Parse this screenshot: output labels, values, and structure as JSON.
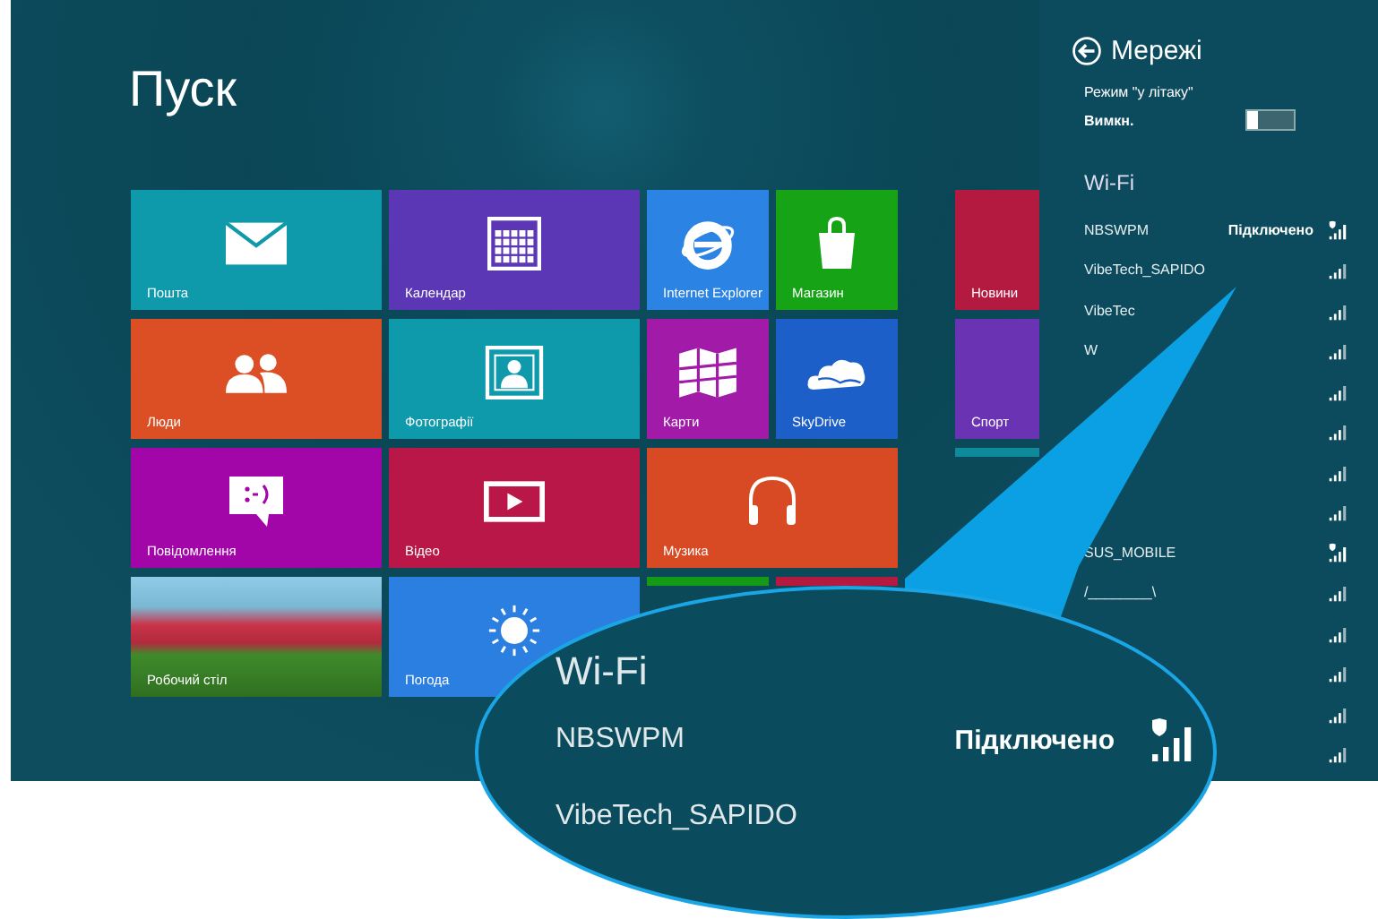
{
  "start": {
    "title": "Пуск",
    "groups": [
      {
        "tiles": [
          {
            "label": "Пошта",
            "kind": "mail",
            "wide": true,
            "color": "#0e9aab"
          },
          {
            "label": "Календар",
            "kind": "calendar",
            "wide": true,
            "color": "#5b37b5"
          },
          {
            "label": "Internet Explorer",
            "kind": "browser",
            "wide": false,
            "color": "#2b83e3"
          },
          {
            "label": "Магазин",
            "kind": "store",
            "wide": false,
            "color": "#17a316"
          },
          {
            "label": "Люди",
            "kind": "people",
            "wide": true,
            "color": "#dc4f25"
          },
          {
            "label": "Фотографії",
            "kind": "photos",
            "wide": true,
            "color": "#0e9aab"
          },
          {
            "label": "Карти",
            "kind": "maps",
            "wide": false,
            "color": "#a21aa8"
          },
          {
            "label": "SkyDrive",
            "kind": "cloud",
            "wide": false,
            "color": "#1d5fc8"
          },
          {
            "label": "Повідомлення",
            "kind": "messaging",
            "wide": true,
            "color": "#a306a8"
          },
          {
            "label": "Відео",
            "kind": "video",
            "wide": true,
            "color": "#b91747"
          },
          {
            "label": "Музика",
            "kind": "music",
            "wide": true,
            "color": "#d84a23"
          },
          {
            "label": "Робочий стіл",
            "kind": "photo",
            "wide": true
          },
          {
            "label": "Погода",
            "kind": "weather",
            "wide": true,
            "color": "#2b7fe0"
          },
          {
            "kind": "none",
            "wide": false,
            "color": "#159a17"
          },
          {
            "kind": "none",
            "wide": false,
            "color": "#b4193f"
          }
        ]
      },
      {
        "tiles": [
          {
            "label": "Новини",
            "kind": "none",
            "wide": false,
            "color": "#b4193f"
          },
          {
            "label": "Спорт",
            "kind": "none",
            "wide": false,
            "color": "#6a33b3"
          },
          {
            "kind": "none",
            "wide": false,
            "color": "#0e8a9b"
          }
        ]
      }
    ]
  },
  "panel": {
    "title": "Мережі",
    "airplane": {
      "label": "Режим \"у літаку\"",
      "state": "Вимкн.",
      "on": false
    },
    "section": "Wi-Fi",
    "networks": [
      {
        "name": "NBSWPM",
        "status": "Підключено",
        "secured": true
      },
      {
        "name": "VibeTech_SAPIDO",
        "secured": false
      },
      {
        "name": "VibeTec",
        "secured": false
      },
      {
        "name": "W",
        "secured": false
      },
      {
        "secured": false
      },
      {
        "secured": false
      },
      {
        "secured": false
      },
      {
        "secured": false
      },
      {
        "name": "SUS_MOBILE",
        "secured": true
      },
      {
        "name": "/________\\",
        "secured": false
      },
      {
        "secured": false
      },
      {
        "secured": false
      },
      {
        "secured": false
      },
      {
        "secured": false
      }
    ]
  },
  "callout": {
    "title": "Wi-Fi",
    "networks": [
      {
        "name": "NBSWPM",
        "status": "Підключено",
        "secured": true
      },
      {
        "name": "VibeTech_SAPIDO"
      }
    ]
  }
}
